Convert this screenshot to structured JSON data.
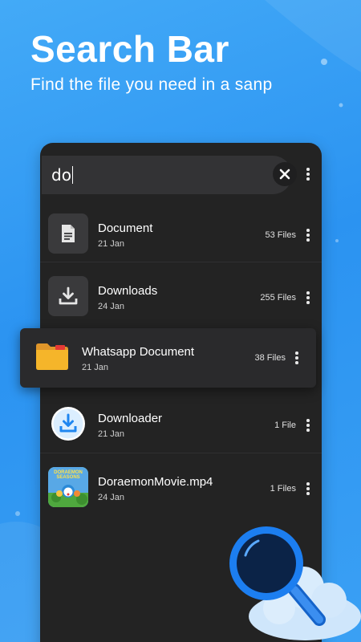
{
  "promo": {
    "headline": "Search Bar",
    "subline": "Find the file you need in a sanp"
  },
  "search": {
    "query": "do",
    "clear_icon": "close-icon",
    "menu_icon": "more-vert-icon"
  },
  "results": [
    {
      "name": "Document",
      "date": "21 Jan",
      "count": "53 Files",
      "icon": "document-icon"
    },
    {
      "name": "Downloads",
      "date": "24 Jan",
      "count": "255 Files",
      "icon": "download-icon"
    },
    {
      "name": "Whatsapp Document",
      "date": "21 Jan",
      "count": "38 Files",
      "icon": "folder-icon",
      "highlighted": true
    },
    {
      "name": "Downloader",
      "date": "21 Jan",
      "count": "1 File",
      "icon": "downloader-app-icon"
    },
    {
      "name": "DoraemonMovie.mp4",
      "date": "24 Jan",
      "count": "1 Files",
      "icon": "video-thumbnail",
      "thumb_text": "DORAEMON SEASONS"
    }
  ],
  "colors": {
    "background": "#2b93f1",
    "panel": "#232323",
    "folder": "#f5b52a",
    "accent": "#1f86f0"
  }
}
